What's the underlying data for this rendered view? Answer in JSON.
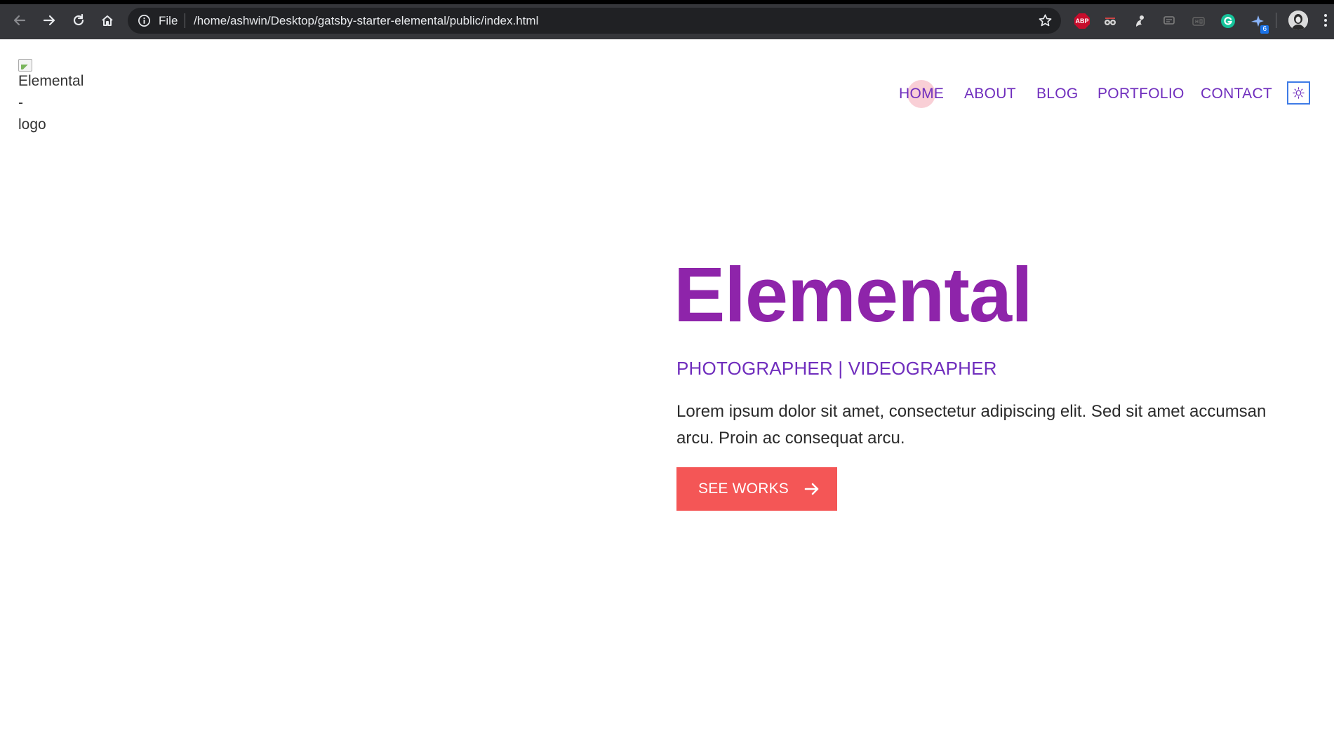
{
  "browser": {
    "file_label": "File",
    "url": "/home/ashwin/Desktop/gatsby-starter-elemental/public/index.html",
    "extension_badge": "6",
    "extension_abp_label": "ABP",
    "icons": [
      "back-icon",
      "forward-icon",
      "reload-icon",
      "home-icon",
      "info-icon",
      "star-icon",
      "adblock-icon",
      "extension-icon",
      "extension-icon",
      "extension-icon",
      "extension-icon",
      "grammarly-icon",
      "translate-icon",
      "avatar",
      "more-icon"
    ]
  },
  "site": {
    "logo_alt_line1": "Elemental",
    "logo_alt_line2": "-",
    "logo_alt_line3": "logo",
    "nav": {
      "home": "HOME",
      "about": "ABOUT",
      "blog": "BLOG",
      "portfolio": "PORTFOLIO",
      "contact": "CONTACT"
    },
    "theme_toggle_icon": "sun-icon"
  },
  "hero": {
    "title": "Elemental",
    "subtitle": "PHOTOGRAPHER | VIDEOGRAPHER",
    "description": "Lorem ipsum dolor sit amet, consectetur adipiscing elit. Sed sit amet accumsan arcu. Proin ac consequat arcu.",
    "cta_label": "SEE WORKS"
  },
  "colors": {
    "chrome": "#35363a",
    "omnibox": "#202124",
    "nav_link": "#6f2dbd",
    "title": "#8e24aa",
    "cta": "#f45656",
    "home_halo": "#f9cfd6",
    "toggle_border": "#3e7be6"
  }
}
